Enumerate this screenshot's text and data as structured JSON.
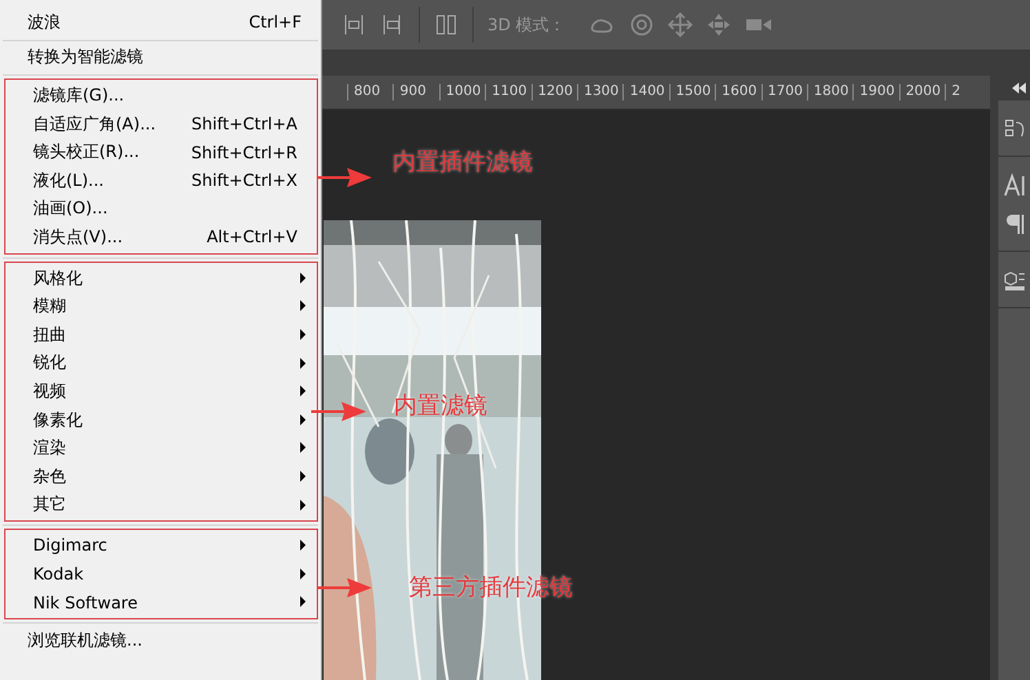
{
  "toolbar": {
    "mode_label": "3D 模式："
  },
  "ruler": {
    "ticks": [
      "800",
      "900",
      "1000",
      "1100",
      "1200",
      "1300",
      "1400",
      "1500",
      "1600",
      "1700",
      "1800",
      "1900",
      "2000",
      "2"
    ]
  },
  "menu": {
    "sections": [
      {
        "outlined": false,
        "items": [
          {
            "label": "波浪",
            "shortcut": "Ctrl+F",
            "submenu": false
          }
        ]
      },
      {
        "outlined": false,
        "items": [
          {
            "label": "转换为智能滤镜",
            "submenu": false
          }
        ]
      },
      {
        "outlined": true,
        "items": [
          {
            "label": "滤镜库(G)...",
            "submenu": false
          },
          {
            "label": "自适应广角(A)...",
            "shortcut": "Shift+Ctrl+A",
            "submenu": false
          },
          {
            "label": "镜头校正(R)...",
            "shortcut": "Shift+Ctrl+R",
            "submenu": false
          },
          {
            "label": "液化(L)...",
            "shortcut": "Shift+Ctrl+X",
            "submenu": false
          },
          {
            "label": "油画(O)...",
            "submenu": false
          },
          {
            "label": "消失点(V)...",
            "shortcut": "Alt+Ctrl+V",
            "submenu": false
          }
        ]
      },
      {
        "outlined": true,
        "items": [
          {
            "label": "风格化",
            "submenu": true
          },
          {
            "label": "模糊",
            "submenu": true
          },
          {
            "label": "扭曲",
            "submenu": true
          },
          {
            "label": "锐化",
            "submenu": true
          },
          {
            "label": "视频",
            "submenu": true
          },
          {
            "label": "像素化",
            "submenu": true
          },
          {
            "label": "渲染",
            "submenu": true
          },
          {
            "label": "杂色",
            "submenu": true
          },
          {
            "label": "其它",
            "submenu": true
          }
        ]
      },
      {
        "outlined": true,
        "items": [
          {
            "label": "Digimarc",
            "submenu": true
          },
          {
            "label": "Kodak",
            "submenu": true
          },
          {
            "label": "Nik Software",
            "submenu": true
          }
        ]
      },
      {
        "outlined": false,
        "items": [
          {
            "label": "浏览联机滤镜...",
            "submenu": false
          }
        ]
      }
    ]
  },
  "annotations": [
    {
      "text": "内置插件滤镜"
    },
    {
      "text": "内置滤镜"
    },
    {
      "text": "第三方插件滤镜"
    }
  ]
}
